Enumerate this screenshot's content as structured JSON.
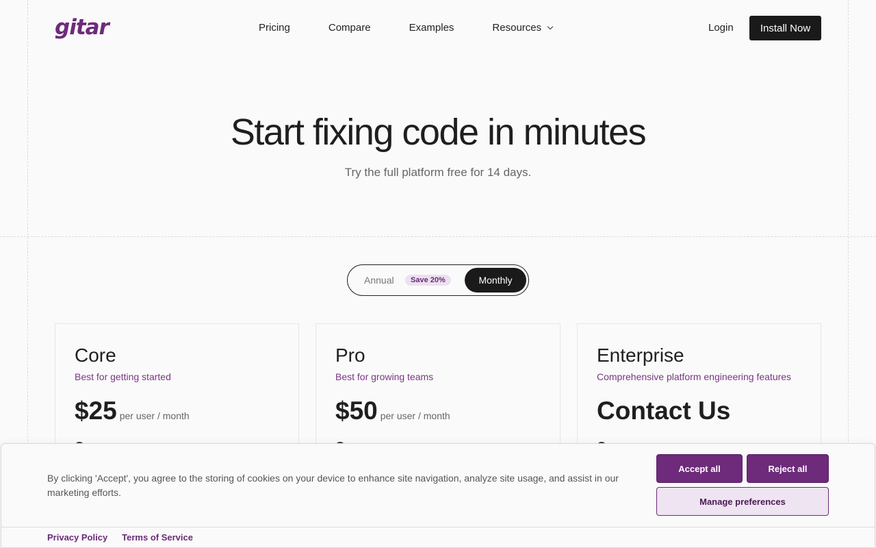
{
  "nav": {
    "logo_text": "gitar",
    "links": [
      {
        "label": "Pricing"
      },
      {
        "label": "Compare"
      },
      {
        "label": "Examples"
      },
      {
        "label": "Resources"
      }
    ],
    "login_label": "Login",
    "install_label": "Install Now"
  },
  "hero": {
    "title": "Start fixing code in minutes",
    "subtitle": "Try the full platform free for 14 days."
  },
  "billing_toggle": {
    "annual_label": "Annual",
    "save_badge": "Save 20%",
    "monthly_label": "Monthly",
    "selected": "Monthly"
  },
  "plans": [
    {
      "name": "Core",
      "description": "Best for getting started",
      "price": "$25",
      "period": "per user / month"
    },
    {
      "name": "Pro",
      "description": "Best for growing teams",
      "price": "$50",
      "period": "per user / month"
    },
    {
      "name": "Enterprise",
      "description": "Comprehensive platform engineering features",
      "price": "Contact Us",
      "period": ""
    }
  ],
  "cookie_banner": {
    "text": "By clicking 'Accept', you agree to the storing of cookies on your device to enhance site navigation, analyze site usage, and assist in our marketing efforts.",
    "accept_label": "Accept all",
    "reject_label": "Reject all",
    "manage_label": "Manage preferences",
    "privacy_label": "Privacy Policy",
    "terms_label": "Terms of Service"
  },
  "colors": {
    "brand": "#6e2a7b",
    "dark": "#1a1a1a",
    "background": "#fafafa"
  }
}
